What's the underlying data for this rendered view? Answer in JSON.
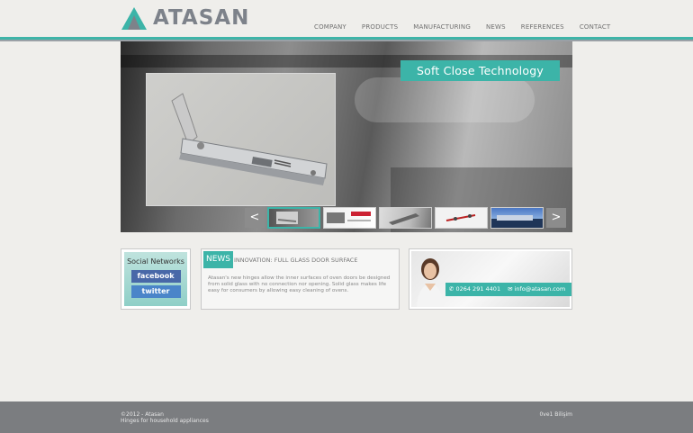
{
  "brand": {
    "name": "ATASAN",
    "accent": "#3cb4a8",
    "logo_icon": "mountain-logo-icon"
  },
  "nav": [
    "COMPANY",
    "PRODUCTS",
    "MANUFACTURING",
    "NEWS",
    "REFERENCES",
    "CONTACT"
  ],
  "slider": {
    "title": "Soft Close Technology",
    "prev": "<",
    "next": ">",
    "thumb_count": 5,
    "active_thumb": 1
  },
  "social": {
    "title": "Social Networks",
    "facebook": "facebook",
    "twitter": "twitter"
  },
  "news": {
    "tag": "NEWS",
    "headline": "INNOVATION: FULL GLASS DOOR SURFACE",
    "body": "Atasan's new hinges allow the inner surfaces of oven doors be designed from solid glass with no connection nor opening. Solid glass makes life easy for consumers by allowing easy cleaning of ovens."
  },
  "contact": {
    "phone": "0264 291 4401",
    "email": "info@atasan.com"
  },
  "footer": {
    "copyright": "©2012 - Atasan",
    "tagline": "Hinges for household appliances",
    "credit": "0ve1 Bilişim"
  }
}
